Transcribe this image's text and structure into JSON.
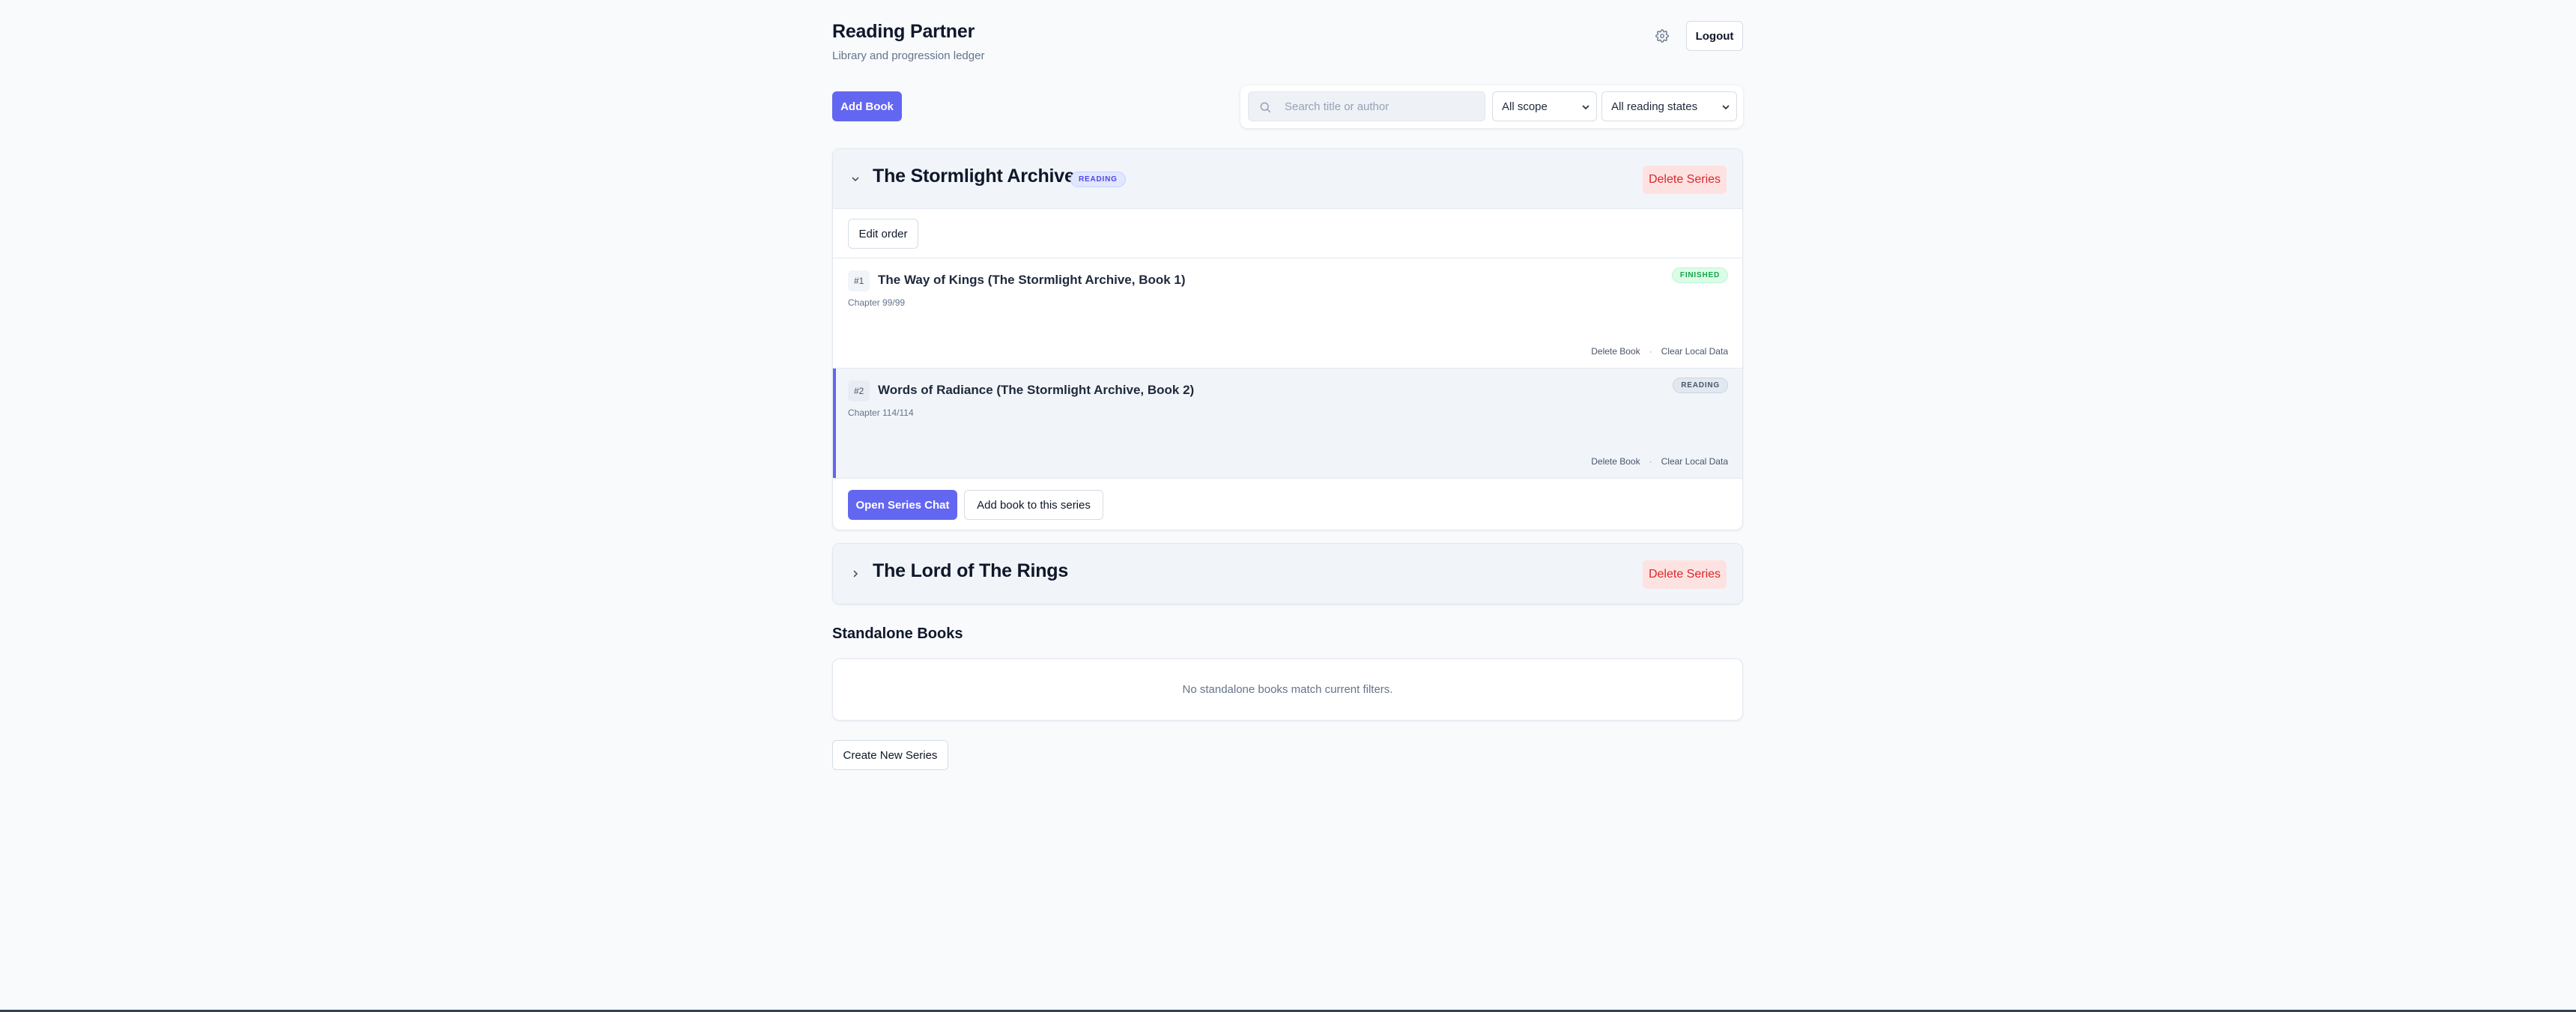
{
  "header": {
    "title": "Reading Partner",
    "subtitle": "Library and progression ledger",
    "logout_label": "Logout",
    "settings_icon": "gear-icon"
  },
  "toolbar": {
    "add_book_label": "Add Book",
    "search": {
      "placeholder": "Search title or author",
      "value": ""
    },
    "scope_select": {
      "selected": "All scope"
    },
    "state_select": {
      "selected": "All reading states"
    }
  },
  "series": [
    {
      "title": "The Stormlight Archive",
      "status": "READING",
      "expanded": true,
      "delete_label": "Delete Series",
      "edit_order_label": "Edit order",
      "books": [
        {
          "number": "#1",
          "title": "The Way of Kings (The Stormlight Archive, Book 1)",
          "progress": "Chapter 99/99",
          "status": "FINISHED",
          "delete_label": "Delete Book",
          "separator": "·",
          "clear_label": "Clear Local Data"
        },
        {
          "number": "#2",
          "title": "Words of Radiance (The Stormlight Archive, Book 2)",
          "progress": "Chapter 114/114",
          "status": "READING",
          "delete_label": "Delete Book",
          "separator": "·",
          "clear_label": "Clear Local Data"
        }
      ],
      "open_chat_label": "Open Series Chat",
      "add_book_label": "Add book to this series"
    },
    {
      "title": "The Lord of The Rings",
      "expanded": false,
      "delete_label": "Delete Series"
    }
  ],
  "standalone": {
    "heading": "Standalone Books",
    "empty_message": "No standalone books match current filters."
  },
  "create_series_label": "Create New Series",
  "colors": {
    "accent": "#6366f1",
    "danger": "#dc2626",
    "success": "#16a34a",
    "background": "#f8fafc"
  }
}
